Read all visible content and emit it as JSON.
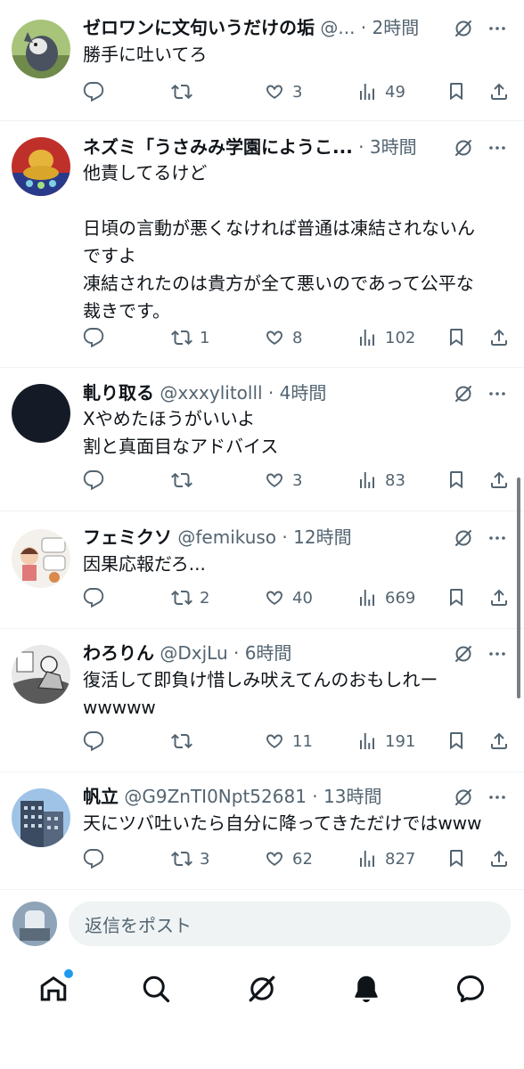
{
  "posts": [
    {
      "name": "ゼロワンに文句いうだけの垢",
      "handle": "@...",
      "time": "2時間",
      "text": "勝手に吐いてろ",
      "replies": "",
      "reposts": "",
      "likes": "3",
      "views": "49",
      "avatar": "cartoon-cat"
    },
    {
      "name": "ネズミ「うさみみ学園にようこ...",
      "handle": "",
      "time": "3時間",
      "text": "他責してるけど\n\n日頃の言動が悪くなければ普通は凍結されないん\nですよ\n凍結されたのは貴方が全て悪いのであって公平な\n裁きです。",
      "replies": "",
      "reposts": "1",
      "likes": "8",
      "views": "102",
      "avatar": "golden-statue"
    },
    {
      "name": "軋り取る",
      "handle": "@xxxylitolll",
      "time": "4時間",
      "text": "Xやめたほうがいいよ\n割と真面目なアドバイス",
      "replies": "",
      "reposts": "",
      "likes": "3",
      "views": "83",
      "avatar": "dark-circle"
    },
    {
      "name": "フェミクソ",
      "handle": "@femikuso",
      "time": "12時間",
      "text": "因果応報だろ...",
      "replies": "",
      "reposts": "2",
      "likes": "40",
      "views": "669",
      "avatar": "illustrated-person"
    },
    {
      "name": "わろりん",
      "handle": "@DxjLu",
      "time": "6時間",
      "text": "復活して即負け惜しみ吠えてんのおもしれー\nwwwww",
      "replies": "",
      "reposts": "",
      "likes": "11",
      "views": "191",
      "avatar": "manga-panel"
    },
    {
      "name": "帆立",
      "handle": "@G9ZnTI0Npt52681",
      "time": "13時間",
      "text": "天にツバ吐いたら自分に降ってきただけではwww",
      "replies": "",
      "reposts": "3",
      "likes": "62",
      "views": "827",
      "avatar": "building-photo"
    }
  ],
  "reply_bar": {
    "placeholder": "返信をポスト"
  },
  "tabbar": {
    "items": [
      "home-icon",
      "search-icon",
      "grok-icon",
      "notifications-icon",
      "messages-icon"
    ],
    "notification_dot_color": "#1d9bf0"
  },
  "colors": {
    "text": "#0f1419",
    "muted": "#536471",
    "divider": "#eff3f4",
    "accent": "#1d9bf0"
  }
}
